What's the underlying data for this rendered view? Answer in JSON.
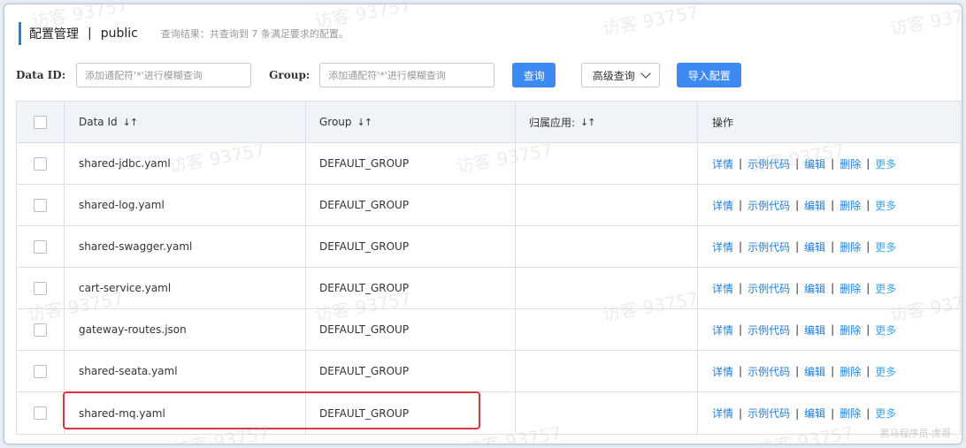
{
  "header": {
    "title": "配置管理",
    "separator": "|",
    "namespace": "public",
    "result_text": "查询结果：共查询到 7 条满足要求的配置。"
  },
  "search": {
    "data_id_label": "Data ID:",
    "data_id_placeholder": "添加通配符'*'进行模糊查询",
    "group_label": "Group:",
    "group_placeholder": "添加通配符'*'进行模糊查询",
    "query_button": "查询",
    "advanced_button": "高级查询",
    "import_button": "导入配置"
  },
  "table": {
    "columns": [
      "Data Id",
      "Group",
      "归属应用:",
      "操作"
    ],
    "sort_glyph": "↓↑",
    "rows": [
      {
        "data_id": "shared-jdbc.yaml",
        "group": "DEFAULT_GROUP",
        "app": ""
      },
      {
        "data_id": "shared-log.yaml",
        "group": "DEFAULT_GROUP",
        "app": ""
      },
      {
        "data_id": "shared-swagger.yaml",
        "group": "DEFAULT_GROUP",
        "app": ""
      },
      {
        "data_id": "cart-service.yaml",
        "group": "DEFAULT_GROUP",
        "app": ""
      },
      {
        "data_id": "gateway-routes.json",
        "group": "DEFAULT_GROUP",
        "app": ""
      },
      {
        "data_id": "shared-seata.yaml",
        "group": "DEFAULT_GROUP",
        "app": ""
      },
      {
        "data_id": "shared-mq.yaml",
        "group": "DEFAULT_GROUP",
        "app": ""
      }
    ],
    "actions": {
      "detail": "详情",
      "sample_code": "示例代码",
      "edit": "编辑",
      "delete": "删除",
      "more": "更多",
      "separator": "|"
    }
  },
  "watermark": "访客 93757",
  "credit": "黑马程序员·虎哥",
  "colors": {
    "accent": "#1f86d8",
    "primary_button": "#3d8bf2",
    "link": "#1d7ddc",
    "more_link": "#39a6f0",
    "highlight_border": "#d9363e",
    "table_header_bg": "#f0f3f7"
  }
}
